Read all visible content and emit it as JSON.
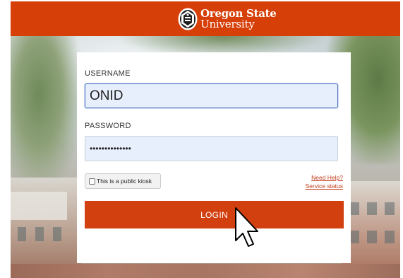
{
  "header": {
    "logo_line1": "Oregon State",
    "logo_line2": "University",
    "brand_color": "#d73f09"
  },
  "login_form": {
    "username_label": "USERNAME",
    "username_value": "ONID",
    "password_label": "PASSWORD",
    "password_value": "••••••••••••••",
    "kiosk_checkbox_label": "This is a public kiosk",
    "kiosk_checked": false,
    "need_help_link": "Need Help?",
    "service_status_link": "Service status",
    "login_button_label": "LOGIN",
    "accent_color": "#d24010",
    "link_color": "#c23b1a"
  },
  "cursor": {
    "type": "hand-pointer-icon"
  }
}
